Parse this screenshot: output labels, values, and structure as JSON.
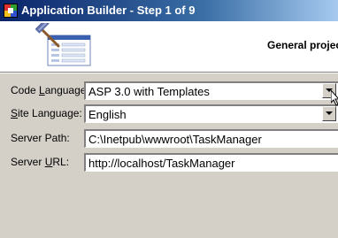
{
  "window": {
    "title": "Application Builder - Step 1 of 9",
    "icon": "app-builder-icon"
  },
  "header": {
    "title": "General project",
    "graphic": "wizard-hammer-form-icon"
  },
  "form": {
    "code_language": {
      "label_pre": "Code ",
      "label_access": "L",
      "label_post": "anguage:",
      "value": "ASP 3.0 with Templates"
    },
    "site_language": {
      "label_pre": "",
      "label_access": "S",
      "label_post": "ite Language:",
      "value": "English"
    },
    "server_path": {
      "label_pre": "Server Path:",
      "label_access": "",
      "label_post": "",
      "value": "C:\\Inetpub\\wwwroot\\TaskManager"
    },
    "server_url": {
      "label_pre": "Server ",
      "label_access": "U",
      "label_post": "RL:",
      "value": "http://localhost/TaskManager"
    }
  },
  "colors": {
    "titlebar_start": "#0a246a",
    "titlebar_end": "#a6caf0",
    "dialog_bg": "#d4d0c8"
  }
}
